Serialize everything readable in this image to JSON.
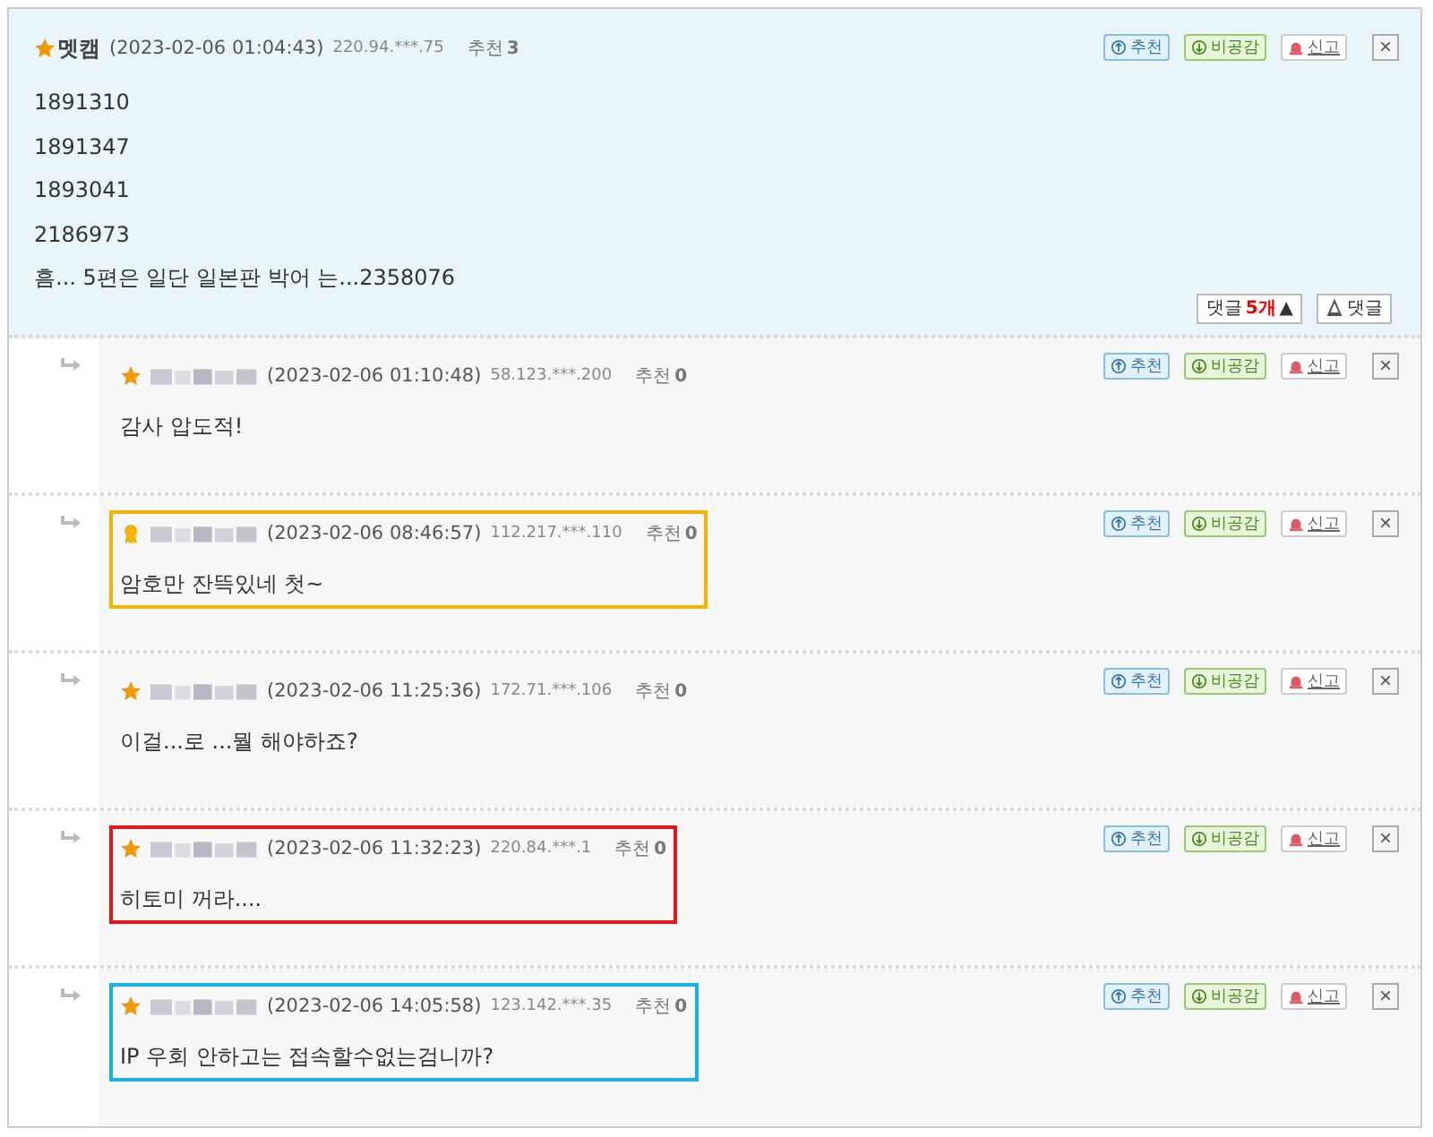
{
  "main_comment": {
    "kind": "star",
    "author": "멧캠",
    "time": "(2023-02-06 01:04:43)",
    "ip": "220.94.***.75",
    "recommend_label": "추천",
    "recommend_count": "3",
    "actions": [
      "추천",
      "비공감",
      "신고"
    ],
    "close": "×",
    "lines": [
      "1891310",
      "1891347",
      "1893041",
      "2186973",
      "흠... 5편은 일단 일본판 박어 는...2358076"
    ],
    "reply_count": {
      "label": "댓글",
      "count": "5개",
      "arrow": "▲"
    },
    "reply_button": "댓글"
  },
  "replies": [
    {
      "kind": "star",
      "author_hidden": true,
      "time": "(2023-02-06 01:10:48)",
      "ip": "58.123.***.200",
      "recommend_label": "추천",
      "recommend_count": "0",
      "actions": [
        "추천",
        "비공감",
        "신고"
      ],
      "close": "×",
      "text": "감사 압도적!"
    },
    {
      "kind": "medal",
      "author_hidden": true,
      "time": "(2023-02-06 08:46:57)",
      "ip": "112.217.***.110",
      "recommend_label": "추천",
      "recommend_count": "0",
      "actions": [
        "추천",
        "비공감",
        "신고"
      ],
      "close": "×",
      "text": "암호만 잔뜩있네 첫~",
      "color": "#f5b400"
    },
    {
      "kind": "star",
      "author_hidden": true,
      "time": "(2023-02-06 11:25:36)",
      "ip": "172.71.***.106",
      "recommend_label": "추천",
      "recommend_count": "0",
      "actions": [
        "추천",
        "비공감",
        "신고"
      ],
      "close": "×",
      "text": "이걸...로 ...뭘 해야하죠?"
    },
    {
      "kind": "star",
      "author_hidden": true,
      "time": "(2023-02-06 11:32:23)",
      "ip": "220.84.***.1",
      "recommend_label": "추천",
      "recommend_count": "0",
      "actions": [
        "추천",
        "비공감",
        "신고"
      ],
      "close": "×",
      "text": "히토미 꺼라....",
      "color": "#e8141b"
    },
    {
      "kind": "star",
      "author_hidden": true,
      "time": "(2023-02-06 14:05:58)",
      "ip": "123.142.***.35",
      "recommend_label": "추천",
      "recommend_count": "0",
      "actions": [
        "추천",
        "비공감",
        "신고"
      ],
      "close": "×",
      "text": "IP 우회 안하고는 접속할수없는검니까?",
      "color": "#1ab0e8"
    }
  ]
}
